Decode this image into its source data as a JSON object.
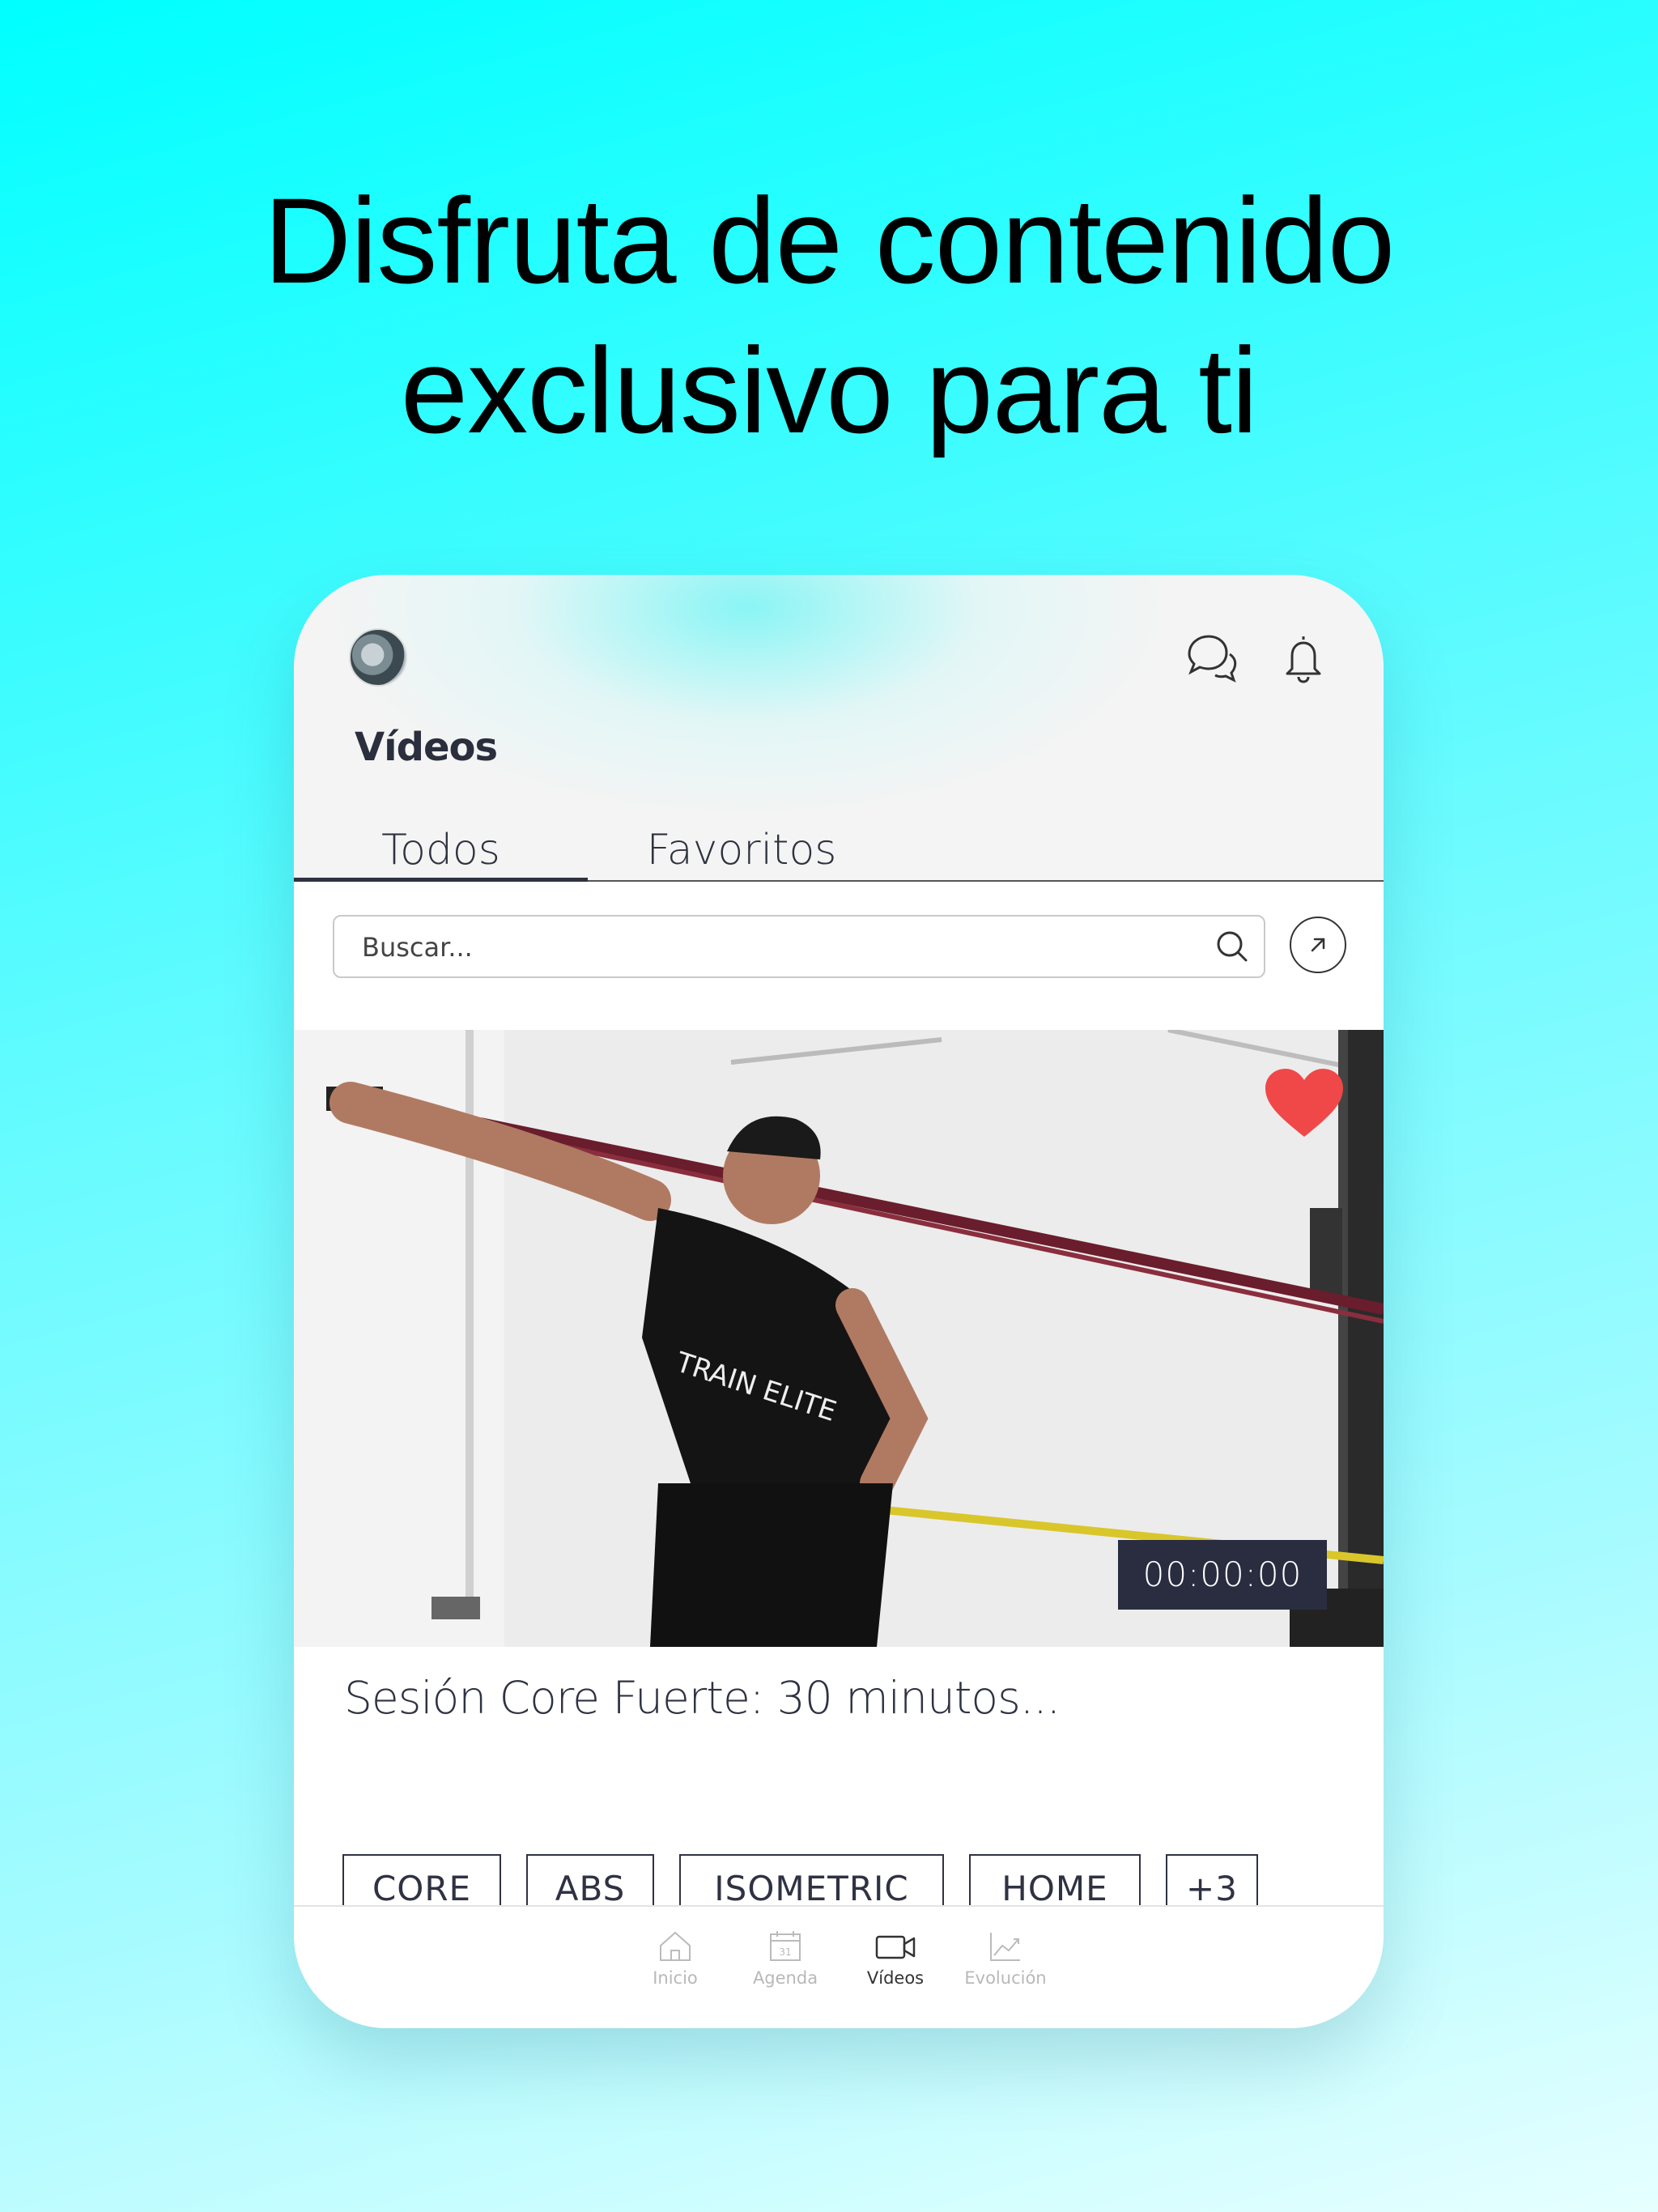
{
  "headline": {
    "line1": "Disfruta de contenido",
    "line2": "exclusivo para ti"
  },
  "app": {
    "header": {
      "avatar": "avatar",
      "chat_icon": "chat-icon",
      "bell_icon": "bell-icon"
    },
    "page_title": "Vídeos",
    "tabs": [
      {
        "label": "Todos",
        "active": true
      },
      {
        "label": "Favoritos",
        "active": false
      }
    ],
    "search": {
      "placeholder": "Buscar...",
      "value": ""
    },
    "video": {
      "favorite": true,
      "timer": "00:00:00",
      "title": "Sesión Core Fuerte: 30 minutos...",
      "tags": [
        "CORE",
        "ABS",
        "ISOMETRIC",
        "HOME",
        "+3"
      ]
    },
    "nav": [
      {
        "label": "Inicio",
        "icon": "home-icon",
        "active": false
      },
      {
        "label": "Agenda",
        "icon": "calendar-icon",
        "active": false,
        "badge": "31"
      },
      {
        "label": "Vídeos",
        "icon": "video-camera-icon",
        "active": true
      },
      {
        "label": "Evolución",
        "icon": "trend-chart-icon",
        "active": false
      }
    ]
  },
  "colors": {
    "accent": "#00ffff",
    "heart": "#f04848",
    "dark": "#2a2d40"
  }
}
